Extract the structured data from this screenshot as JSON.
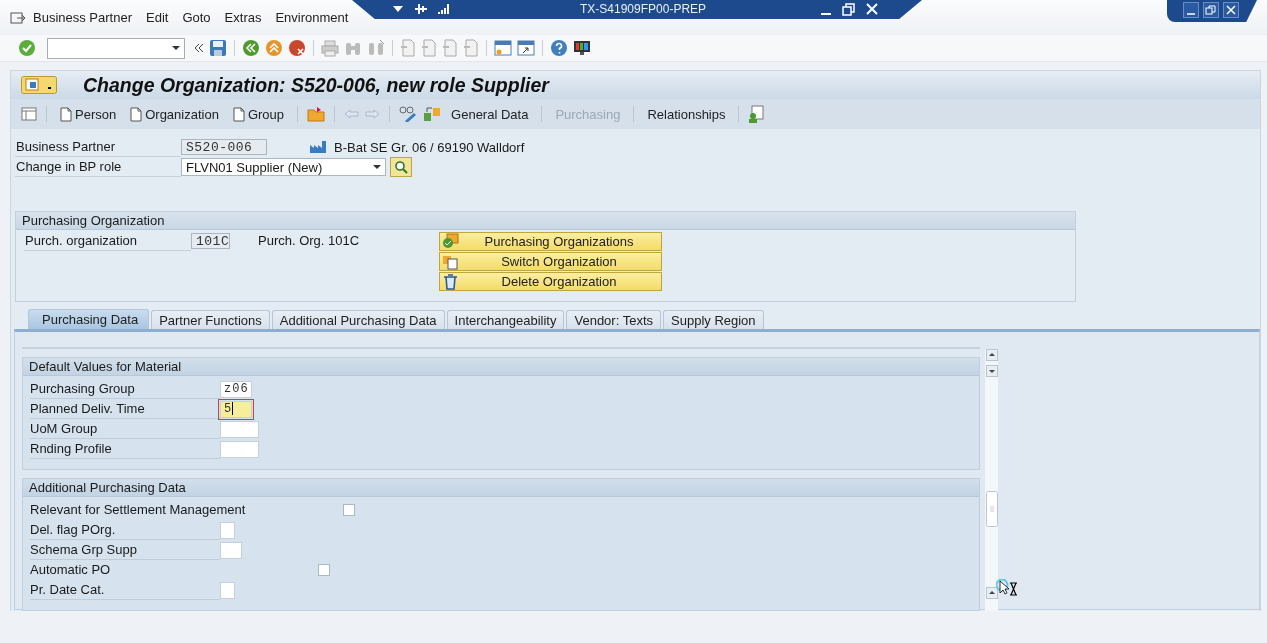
{
  "menu": [
    "Business Partner",
    "Edit",
    "Goto",
    "Extras",
    "Environment"
  ],
  "window_title": "TX-S41909FP00-PREP",
  "screen_title": "Change Organization: S520-006, new role Supplier",
  "app_toolbar": [
    {
      "kind": "create",
      "label": "Person",
      "disabled": false
    },
    {
      "kind": "create",
      "label": "Organization",
      "disabled": false
    },
    {
      "kind": "create",
      "label": "Group",
      "disabled": false
    },
    {
      "kind": "text",
      "label": "General Data",
      "disabled": false
    },
    {
      "kind": "text",
      "label": "Purchasing",
      "disabled": true
    },
    {
      "kind": "text",
      "label": "Relationships",
      "disabled": false
    }
  ],
  "business_partner": {
    "label": "Business Partner",
    "value": "S520-006",
    "description": "B-Bat SE Gr. 06 / 69190 Walldorf"
  },
  "bp_role": {
    "label": "Change in BP role",
    "value": "FLVN01 Supplier (New)"
  },
  "purchasing_org": {
    "title": "Purchasing Organization",
    "label": "Purch. organization",
    "value": "101C",
    "description": "Purch. Org. 101C",
    "buttons": [
      {
        "kind": "select",
        "label": "Purchasing Organizations"
      },
      {
        "kind": "switch",
        "label": "Switch Organization"
      },
      {
        "kind": "delete",
        "label": "Delete Organization"
      }
    ]
  },
  "tabs": [
    {
      "label": "Purchasing Data",
      "selected": true
    },
    {
      "label": "Partner Functions",
      "selected": false
    },
    {
      "label": "Additional Purchasing Data",
      "selected": false
    },
    {
      "label": "Interchangeability",
      "selected": false
    },
    {
      "label": "Vendor: Texts",
      "selected": false
    },
    {
      "label": "Supply Region",
      "selected": false
    }
  ],
  "sections": [
    {
      "title": "Default Values for Material",
      "fields": [
        {
          "kind": "input",
          "label": "Purchasing Group",
          "value": "z06",
          "focused": false
        },
        {
          "kind": "input",
          "label": "Planned Deliv. Time",
          "value": "5",
          "focused": true
        },
        {
          "kind": "wide_input",
          "label": "UoM Group",
          "focused": false
        },
        {
          "kind": "wide_input",
          "label": "Rnding Profile",
          "focused": false
        }
      ]
    },
    {
      "title": "Additional Purchasing Data",
      "fields": [
        {
          "kind": "checkbox",
          "label": "Relevant for Settlement Management",
          "checked": false
        },
        {
          "kind": "narrow_input",
          "label": "Del. flag POrg.",
          "focused": false
        },
        {
          "kind": "small_input",
          "label": "Schema Grp Supp",
          "focused": false
        },
        {
          "kind": "checkbox",
          "label": "Automatic PO",
          "checked": false
        },
        {
          "kind": "narrow_input",
          "label": "Pr. Date Cat.",
          "focused": false
        }
      ]
    }
  ]
}
